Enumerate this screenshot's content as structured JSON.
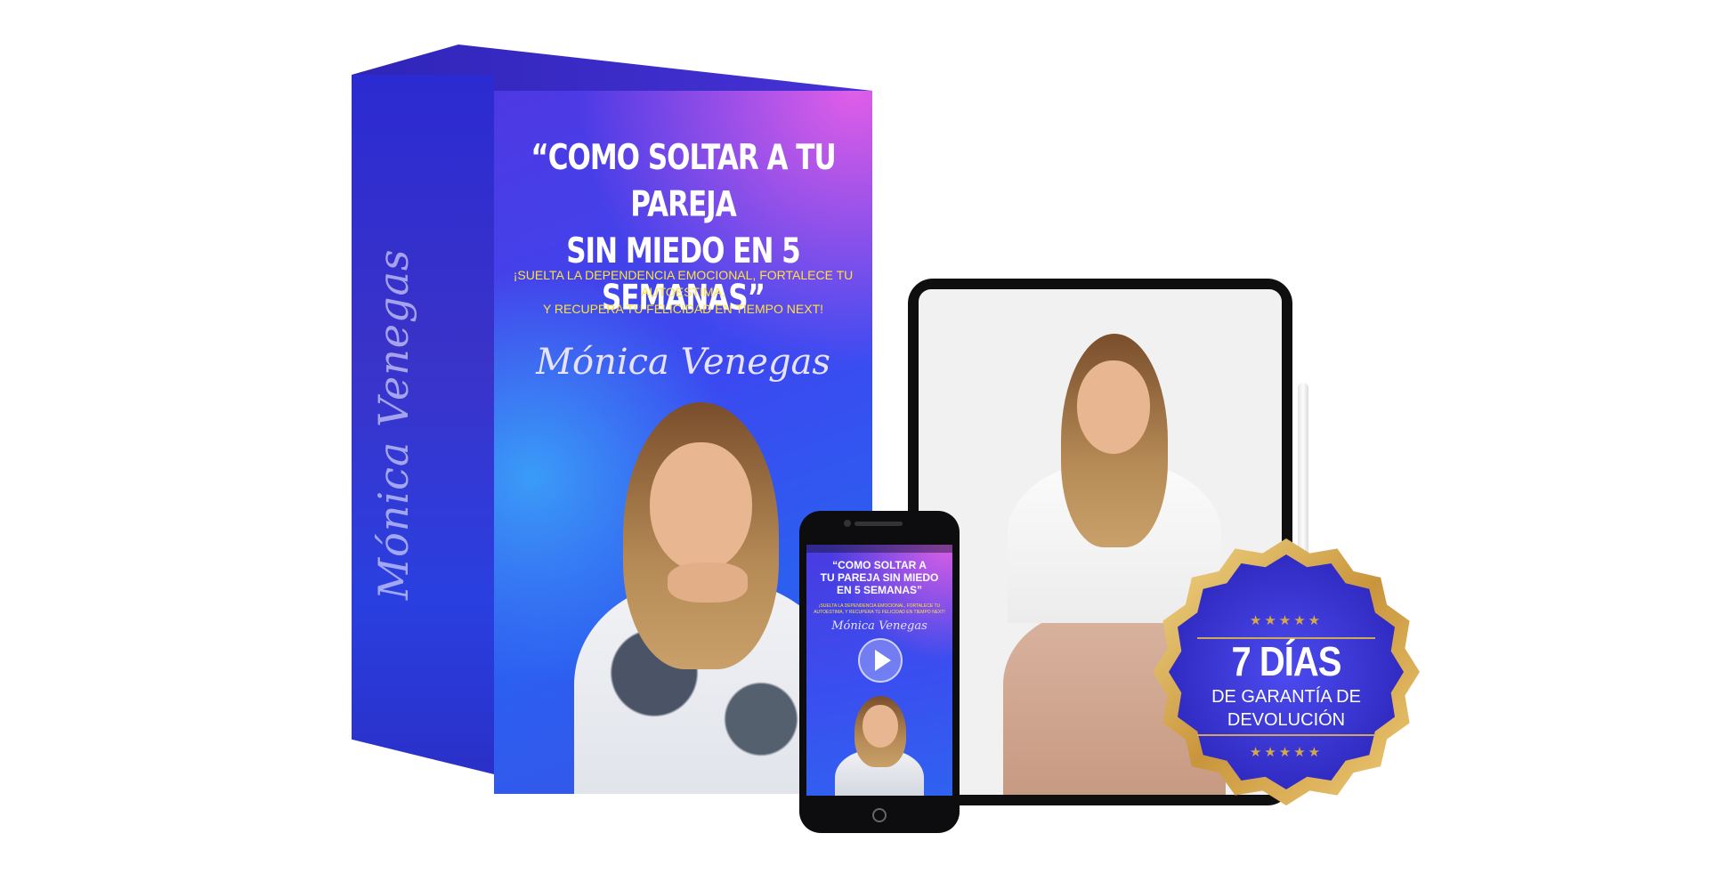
{
  "product_box": {
    "title_line1": "“COMO SOLTAR A TU PAREJA",
    "title_line2": "SIN MIEDO EN 5 SEMANAS”",
    "subtitle_line1": "¡SUELTA LA DEPENDENCIA EMOCIONAL, FORTALECE TU AUTOESTIMA,",
    "subtitle_line2": "Y RECUPERA TU FELICIDAD EN TIEMPO NEXT!",
    "author": "Mónica Venegas",
    "side_author": "Mónica Venegas"
  },
  "phone": {
    "title_line1": "“COMO SOLTAR A",
    "title_line2": "TU PAREJA SIN MIEDO",
    "title_line3": "EN 5 SEMANAS”",
    "subtitle": "¡SUELTA LA DEPENDENCIA EMOCIONAL, FORTALECE TU AUTOESTIMA, Y RECUPERA TU FELICIDAD EN TIEMPO NEXT!",
    "author": "Mónica Venegas",
    "play_icon": "play-icon"
  },
  "badge": {
    "stars": "★★★★★",
    "days": "7 DÍAS",
    "desc_line1": "DE GARANTÍA DE",
    "desc_line2": "DEVOLUCIÓN",
    "colors": {
      "gold": "#d4a94a",
      "blue": "#3a3ae0"
    }
  },
  "colors": {
    "box_blue": "#3a4af0",
    "box_pink": "#e05ee8",
    "subtitle_yellow": "#ffe23d"
  }
}
